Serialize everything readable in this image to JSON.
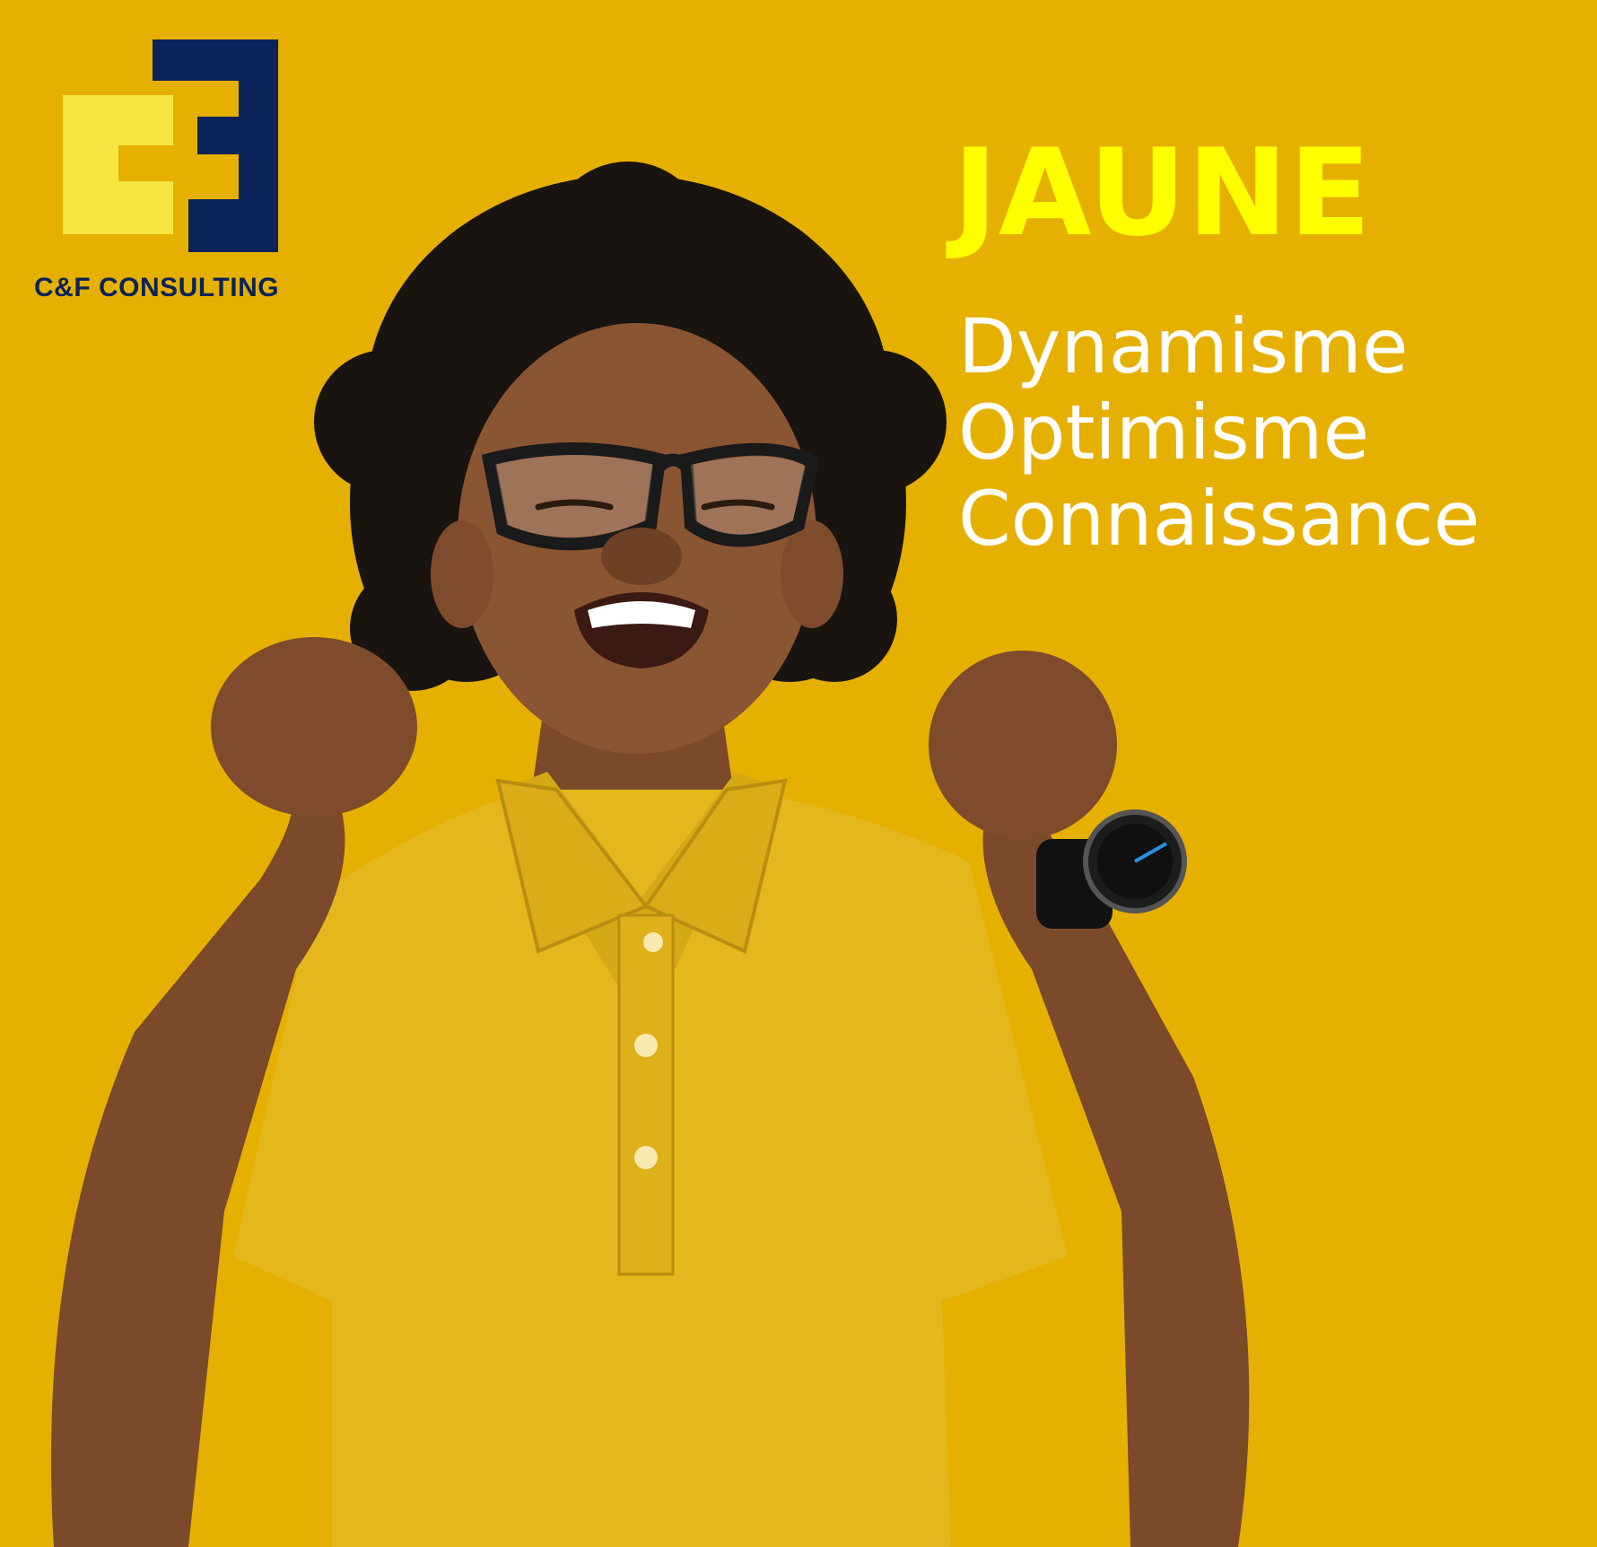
{
  "brand": {
    "name": "C&F CONSULTING",
    "logo_icon": "cf-logo-icon",
    "colors": {
      "navy": "#0B2358",
      "yellow": "#F5E642"
    }
  },
  "headline": {
    "title": "JAUNE",
    "title_color": "#FFFF00",
    "traits": [
      "Dynamisme",
      "Optimisme",
      "Connaissance"
    ],
    "traits_color": "#FFFFFF"
  },
  "background_color": "#E6B000"
}
